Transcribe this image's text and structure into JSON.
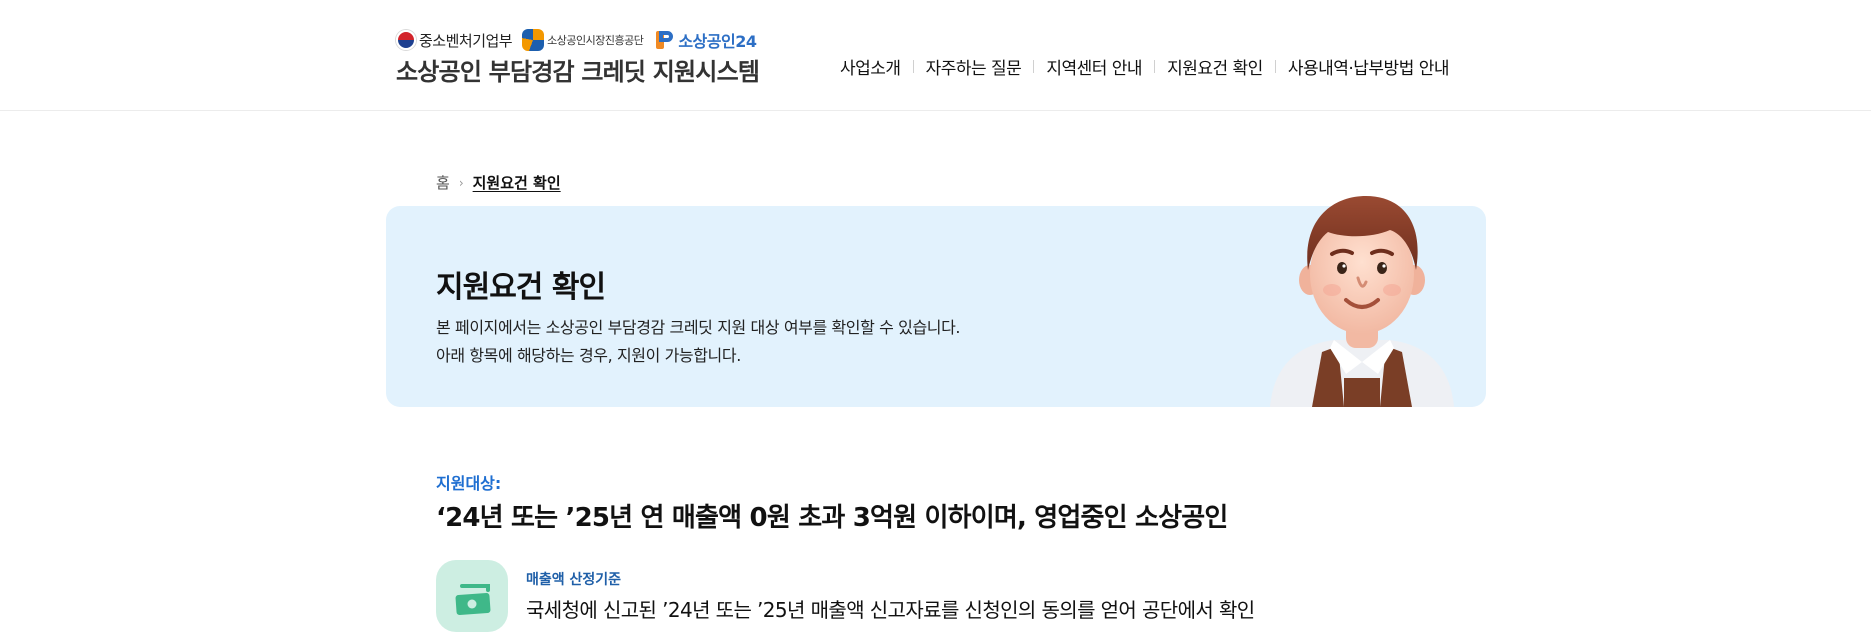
{
  "header": {
    "logos": {
      "ministry": "중소벤처기업부",
      "agency": "소상공인시장진흥공단",
      "portal": "소상공인24"
    },
    "site_title": "소상공인 부담경감 크레딧 지원시스템",
    "nav": [
      {
        "label": "사업소개"
      },
      {
        "label": "자주하는 질문"
      },
      {
        "label": "지역센터 안내"
      },
      {
        "label": "지원요건 확인"
      },
      {
        "label": "사용내역·납부방법 안내"
      }
    ]
  },
  "breadcrumb": {
    "home": "홈",
    "current": "지원요건 확인"
  },
  "banner": {
    "title": "지원요건 확인",
    "desc_line1": "본 페이지에서는 소상공인 부담경감 크레딧 지원 대상 여부를 확인할 수 있습니다.",
    "desc_line2": "아래 항목에 해당하는 경우, 지원이 가능합니다."
  },
  "target": {
    "label": "지원대상:",
    "title": "‘24년 또는 ’25년 연 매출액 0원 초과 3억원 이하이며, 영업중인 소상공인"
  },
  "criteria": {
    "icon": "money-bill-icon",
    "label": "매출액 산정기준",
    "text": "국세청에 신고된 ’24년 또는 ’25년 매출액 신고자료를 신청인의 동의를 얻어 공단에서 확인"
  },
  "colors": {
    "accent_blue": "#1f6fd1",
    "banner_bg": "#e2f2fd",
    "criteria_icon_bg": "#cdeee2"
  }
}
